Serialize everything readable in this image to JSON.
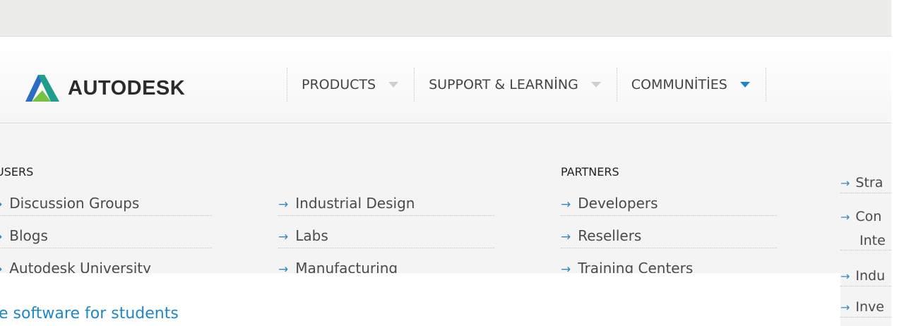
{
  "brand": {
    "name": "AUTODESK"
  },
  "nav": {
    "items": [
      {
        "label": "PRODUCTS",
        "active": false
      },
      {
        "label": "SUPPORT & LEARNİNG",
        "active": false
      },
      {
        "label": "COMMUNİTİES",
        "active": true
      }
    ]
  },
  "dropdown": {
    "users": {
      "heading": "USERS",
      "links": [
        "Discussion Groups",
        "Blogs",
        "Autodesk University"
      ]
    },
    "industries": {
      "links": [
        "Industrial Design",
        "Labs",
        "Manufacturing"
      ]
    },
    "partners": {
      "heading": "PARTNERS",
      "links": [
        "Developers",
        "Resellers",
        "Training Centers"
      ]
    },
    "right_links": [
      "Stra",
      "Con",
      "Inte",
      "Indu",
      "Inve"
    ]
  },
  "page": {
    "heading": "e software for students"
  },
  "icons": {
    "arrow": "→",
    "caret": "caret-down-icon"
  },
  "colors": {
    "accent": "#1d87c8",
    "logo_teal": "#1f9e8e",
    "logo_blue": "#2b6cc4",
    "logo_green": "#76c043"
  }
}
